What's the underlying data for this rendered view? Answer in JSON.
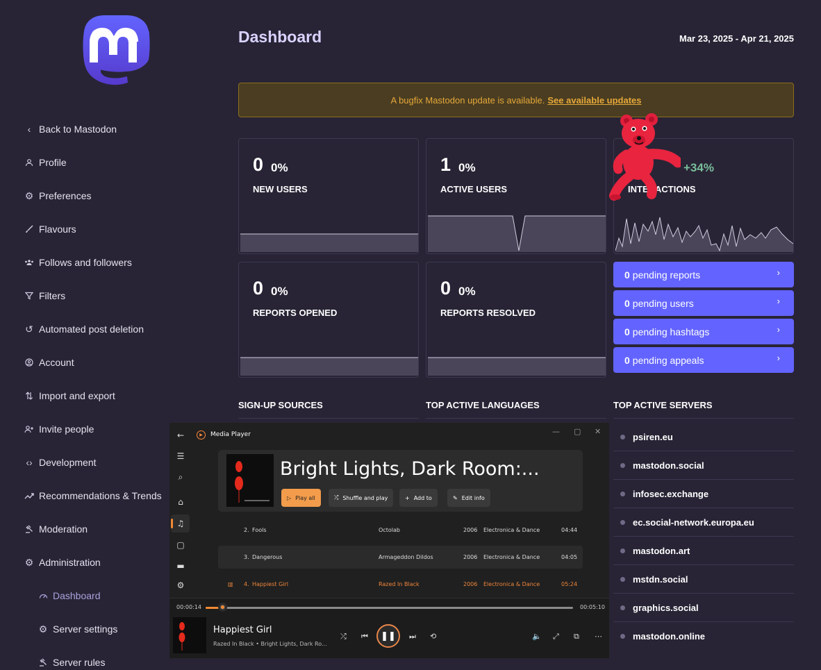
{
  "sidebar": {
    "items": [
      {
        "label": "Back to Mastodon",
        "icon": "chevron-left-icon"
      },
      {
        "label": "Profile",
        "icon": "person-icon"
      },
      {
        "label": "Preferences",
        "icon": "gear-icon"
      },
      {
        "label": "Flavours",
        "icon": "brush-icon"
      },
      {
        "label": "Follows and followers",
        "icon": "group-icon"
      },
      {
        "label": "Filters",
        "icon": "filter-icon"
      },
      {
        "label": "Automated post deletion",
        "icon": "history-icon"
      },
      {
        "label": "Account",
        "icon": "account-circle-icon"
      },
      {
        "label": "Import and export",
        "icon": "import-export-icon"
      },
      {
        "label": "Invite people",
        "icon": "person-add-icon"
      },
      {
        "label": "Development",
        "icon": "code-icon"
      },
      {
        "label": "Recommendations & Trends",
        "icon": "trending-icon"
      },
      {
        "label": "Moderation",
        "icon": "gavel-icon"
      },
      {
        "label": "Administration",
        "icon": "cogs-icon"
      },
      {
        "label": "Dashboard",
        "icon": "speedometer-icon"
      },
      {
        "label": "Server settings",
        "icon": "cogs-icon"
      },
      {
        "label": "Server rules",
        "icon": "gavel-icon"
      }
    ]
  },
  "header": {
    "title": "Dashboard",
    "date_range": "Mar 23, 2025 - Apr 21, 2025"
  },
  "notice": {
    "text": "A bugfix Mastodon update is available.",
    "link": "See available updates"
  },
  "stats": [
    {
      "value": "0",
      "pct": "0%",
      "label": "NEW USERS"
    },
    {
      "value": "1",
      "pct": "0%",
      "label": "ACTIVE USERS"
    },
    {
      "value": "",
      "pct": "+34%",
      "label": "INTERACTIONS"
    },
    {
      "value": "0",
      "pct": "0%",
      "label": "REPORTS OPENED"
    },
    {
      "value": "0",
      "pct": "0%",
      "label": "REPORTS RESOLVED"
    }
  ],
  "pending": [
    {
      "count": "0",
      "label": "pending reports"
    },
    {
      "count": "0",
      "label": "pending users"
    },
    {
      "count": "0",
      "label": "pending hashtags"
    },
    {
      "count": "0",
      "label": "pending appeals"
    }
  ],
  "sections": {
    "signup": "SIGN-UP SOURCES",
    "languages": "TOP ACTIVE LANGUAGES",
    "servers": "TOP ACTIVE SERVERS"
  },
  "servers": [
    "psiren.eu",
    "mastodon.social",
    "infosec.exchange",
    "ec.social-network.europa.eu",
    "mastodon.art",
    "mstdn.social",
    "graphics.social",
    "mastodon.online"
  ],
  "player": {
    "app_title": "Media Player",
    "album_title": "Bright Lights, Dark Room:...",
    "buttons": {
      "play_all": "Play all",
      "shuffle": "Shuffle and play",
      "add_to": "Add to",
      "edit_info": "Edit info"
    },
    "tracks": [
      {
        "num": "2.",
        "title": "Fools",
        "artist": "Octolab",
        "year": "2006",
        "genre": "Electronica & Dance",
        "length": "04:44"
      },
      {
        "num": "3.",
        "title": "Dangerous",
        "artist": "Armageddon Dildos",
        "year": "2006",
        "genre": "Electronica & Dance",
        "length": "04:05"
      },
      {
        "num": "4.",
        "title": "Happiest Girl",
        "artist": "Razed In Black",
        "year": "2006",
        "genre": "Electronica & Dance",
        "length": "05:24"
      }
    ],
    "elapsed": "00:00:14",
    "total": "00:05:10",
    "progress": 0.045,
    "now_title": "Happiest Girl",
    "now_sub": "Razed In Black • Bright Lights, Dark Ro..."
  },
  "colors": {
    "accent": "#6364ff",
    "background": "#282435",
    "warning": "#e6a83a",
    "positive": "#79bd9a",
    "player_accent": "#f08a34"
  }
}
